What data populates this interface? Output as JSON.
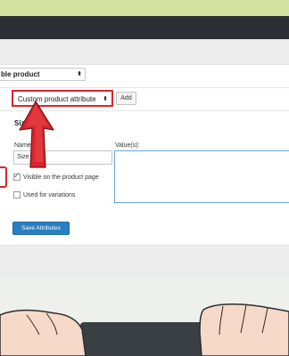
{
  "product_data": {
    "type_select_value": "ble product",
    "attribute_select_value": "Custom product attribute",
    "add_label": "Add"
  },
  "attribute": {
    "heading": "Size",
    "name_label": "Name:",
    "name_value": "Size",
    "values_label": "Value(s):",
    "visible_label": "Visible on the product page",
    "visible_checked": true,
    "variations_label": "Used for variations",
    "variations_checked": false,
    "save_label": "Save Attributes"
  },
  "icons": {
    "annotation_arrow": "up-arrow-icon",
    "select_chevron": "updown-chevron-icon"
  },
  "colors": {
    "highlight": "#d9262e",
    "primary_button": "#2a7fc0",
    "focus_border": "#6aa6d8"
  }
}
